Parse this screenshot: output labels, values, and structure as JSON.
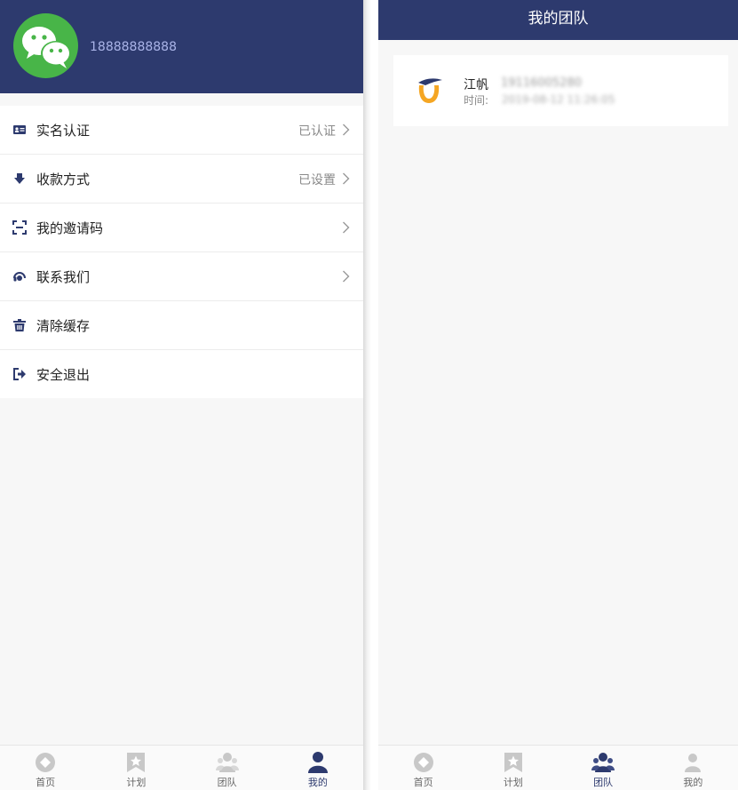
{
  "left": {
    "profile": {
      "phone": "18888888888",
      "avatar_icon": "wechat-icon",
      "avatar_color": "#48b548"
    },
    "menu": [
      {
        "label": "实名认证",
        "value": "已认证",
        "icon": "id-card-icon",
        "arrow": true
      },
      {
        "label": "收款方式",
        "value": "已设置",
        "icon": "download-icon",
        "arrow": true
      },
      {
        "label": "我的邀请码",
        "value": "",
        "icon": "scan-icon",
        "arrow": true
      },
      {
        "label": "联系我们",
        "value": "",
        "icon": "headset-icon",
        "arrow": true
      },
      {
        "label": "清除缓存",
        "value": "",
        "icon": "trash-icon",
        "arrow": false
      },
      {
        "label": "安全退出",
        "value": "",
        "icon": "logout-icon",
        "arrow": false
      }
    ],
    "tabs": [
      {
        "label": "首页",
        "icon": "home-icon",
        "active": false
      },
      {
        "label": "计划",
        "icon": "bookmark-star-icon",
        "active": false
      },
      {
        "label": "团队",
        "icon": "team-icon",
        "active": false
      },
      {
        "label": "我的",
        "icon": "user-icon",
        "active": true
      }
    ]
  },
  "right": {
    "title": "我的团队",
    "member": {
      "name": "江帆",
      "phone": "19116005280",
      "time_label": "时间:",
      "time": "2019-08-12 11:26:05",
      "logo_icon": "team-logo-icon"
    },
    "tabs": [
      {
        "label": "首页",
        "icon": "home-icon",
        "active": false
      },
      {
        "label": "计划",
        "icon": "bookmark-star-icon",
        "active": false
      },
      {
        "label": "团队",
        "icon": "team-icon",
        "active": true
      },
      {
        "label": "我的",
        "icon": "user-icon",
        "active": false
      }
    ]
  },
  "colors": {
    "primary": "#2d3a6e",
    "inactive_icon": "#c8c8c8",
    "accent_orange": "#f5a623",
    "background": "#f7f7f7"
  }
}
